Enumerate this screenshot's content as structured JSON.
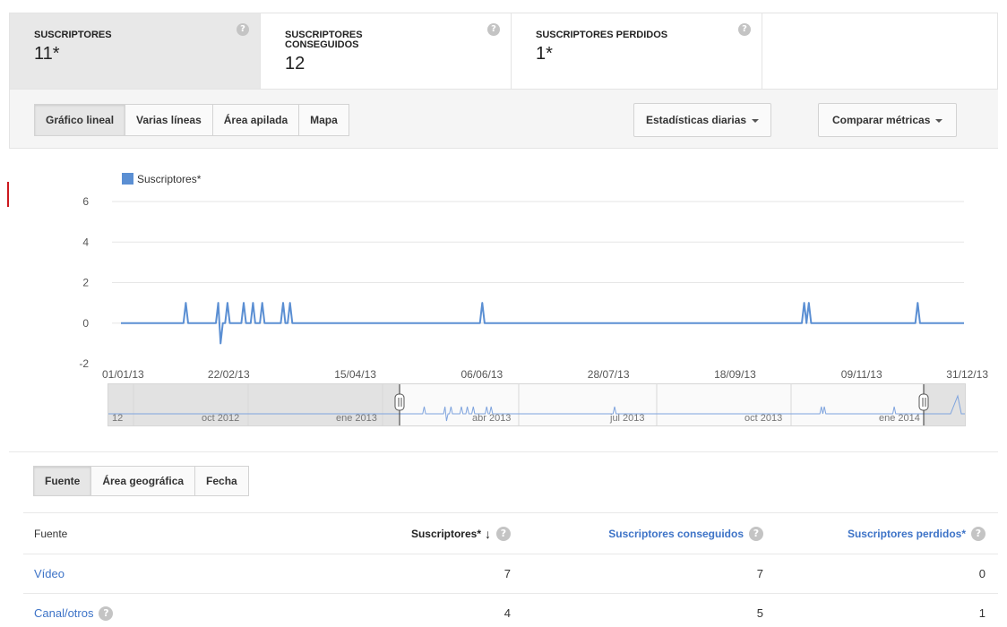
{
  "metrics": [
    {
      "label": "SUSCRIPTORES",
      "value": "11*",
      "active": true
    },
    {
      "label": "SUSCRIPTORES CONSEGUIDOS",
      "value": "12",
      "active": false
    },
    {
      "label": "SUSCRIPTORES PERDIDOS",
      "value": "1*",
      "active": false
    }
  ],
  "help_glyph": "?",
  "chart_tabs": [
    "Gráfico lineal",
    "Varias líneas",
    "Área apilada",
    "Mapa"
  ],
  "dropdowns": {
    "stats": "Estadísticas diarias",
    "compare": "Comparar métricas"
  },
  "chart_data": {
    "type": "line",
    "legend": "Suscriptores*",
    "ylim": [
      -2,
      6
    ],
    "yticks": [
      -2,
      0,
      2,
      4,
      6
    ],
    "x_start": "01/01/13",
    "x_end": "31/12/13",
    "xtick_labels": [
      "01/01/13",
      "22/02/13",
      "15/04/13",
      "06/06/13",
      "28/07/13",
      "18/09/13",
      "09/11/13",
      "31/12/13"
    ],
    "series": [
      {
        "name": "Suscriptores*",
        "points": [
          {
            "date": "2013-01-01",
            "value": 0
          },
          {
            "date": "2013-01-29",
            "value": 1
          },
          {
            "date": "2013-02-12",
            "value": 1
          },
          {
            "date": "2013-02-13",
            "value": -1
          },
          {
            "date": "2013-02-16",
            "value": 1
          },
          {
            "date": "2013-02-23",
            "value": 1
          },
          {
            "date": "2013-02-27",
            "value": 1
          },
          {
            "date": "2013-03-03",
            "value": 1
          },
          {
            "date": "2013-03-12",
            "value": 1
          },
          {
            "date": "2013-03-15",
            "value": 1
          },
          {
            "date": "2013-06-06",
            "value": 1
          },
          {
            "date": "2013-10-23",
            "value": 1
          },
          {
            "date": "2013-10-25",
            "value": 1
          },
          {
            "date": "2013-12-11",
            "value": 1
          },
          {
            "date": "2013-12-31",
            "value": 0
          }
        ]
      }
    ],
    "navigator": {
      "labels": [
        "12",
        "oct 2012",
        "ene 2013",
        "abr 2013",
        "jul 2013",
        "oct 2013",
        "ene 2014"
      ]
    }
  },
  "table_tabs": [
    "Fuente",
    "Área geográfica",
    "Fecha"
  ],
  "table": {
    "headers": [
      "Fuente",
      "Suscriptores*",
      "Suscriptores conseguidos",
      "Suscriptores perdidos*"
    ],
    "sort_arrow": "↓",
    "rows": [
      {
        "source": "Vídeo",
        "subs": "7",
        "gained": "7",
        "lost": "0",
        "help": false
      },
      {
        "source": "Canal/otros",
        "subs": "4",
        "gained": "5",
        "lost": "1",
        "help": true
      }
    ]
  },
  "colors": {
    "series": "#5b8fd3",
    "link": "#3d73c7",
    "accent": "#cc181e"
  }
}
